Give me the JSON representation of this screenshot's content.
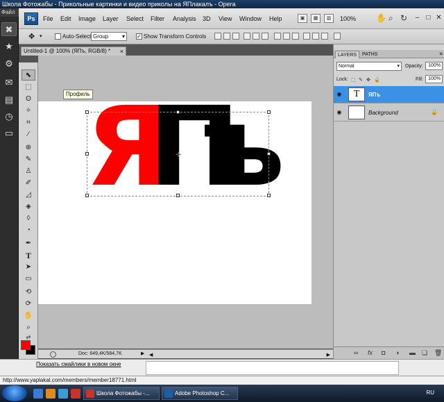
{
  "window": {
    "title": "Школа Фотожабы - Прикольные картинки и видео приколы на ЯПлакалъ - Opera"
  },
  "opera": {
    "files_label": "Файл"
  },
  "ps_menu": {
    "logo": "Ps",
    "items": [
      "File",
      "Edit",
      "Image",
      "Layer",
      "Select",
      "Filter",
      "Analysis",
      "3D",
      "View",
      "Window",
      "Help"
    ],
    "zoom": "100%"
  },
  "options": {
    "auto_select_label": "Auto-Select:",
    "auto_select_value": "Group",
    "show_transform_label": "Show Transform Controls",
    "show_transform_checked": "✓"
  },
  "document": {
    "tab_title": "Untitled-1 @ 100% (ЯПъ, RGB/8) *",
    "tab_close": "×",
    "text_red": "Я",
    "text_black_p": "П",
    "text_black_hard": "ъ",
    "text_red_color": "#ff0000",
    "text_black_color": "#000000",
    "tooltip": "Профиль",
    "status_info": "Doc: 649,4K/584,7K"
  },
  "layers_panel": {
    "tabs": [
      "LAYERS",
      "PATHS"
    ],
    "blend_mode": "Normal",
    "opacity_label": "Opacity:",
    "opacity_value": "100%",
    "lock_label": "Lock:",
    "fill_label": "Fill:",
    "fill_value": "100%",
    "layers": [
      {
        "thumb": "T",
        "name": "ЯПъ",
        "selected": true
      },
      {
        "thumb": "",
        "name": "Background",
        "selected": false
      }
    ]
  },
  "web": {
    "link": "Показать смайлики в новом окне"
  },
  "status_url": "http://www.yaplakal.com/members/member18771.html",
  "taskbar": {
    "tasks": [
      "Школа Фотожабы -...",
      "Adobe Photoshop C..."
    ],
    "lang": "RU"
  },
  "colors": {
    "foreground": "#ff0000",
    "background": "#000000",
    "selection": "#3a91e6"
  }
}
